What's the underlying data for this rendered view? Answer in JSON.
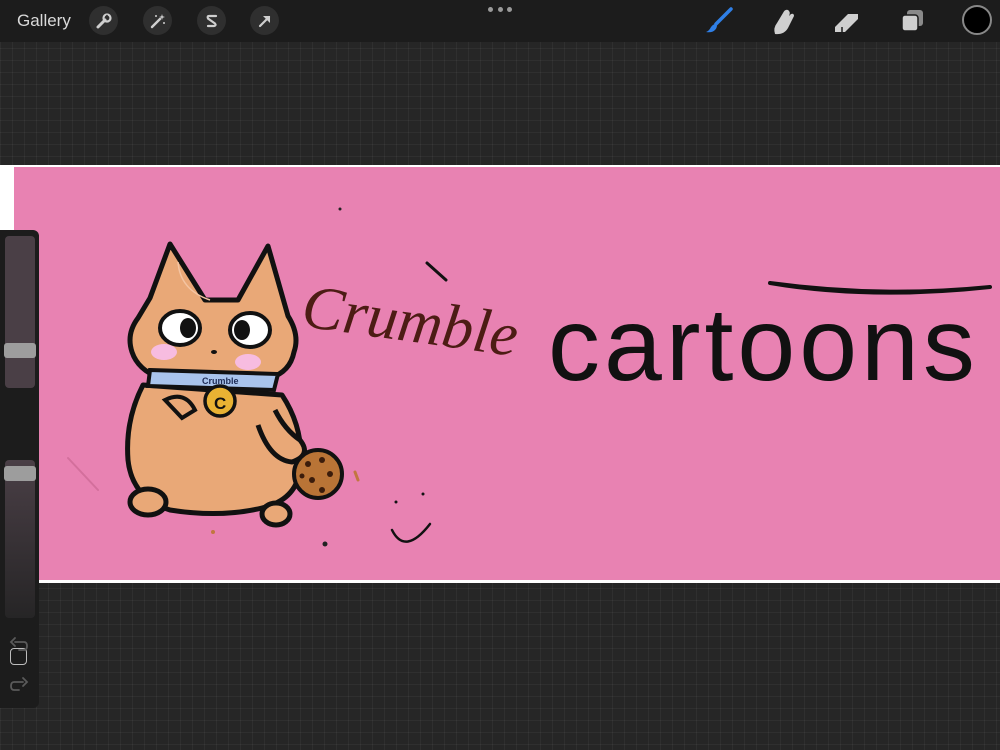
{
  "toolbar": {
    "gallery_label": "Gallery",
    "left_tools": [
      {
        "name": "actions",
        "icon": "wrench-icon"
      },
      {
        "name": "adjustments",
        "icon": "magic-wand-icon"
      },
      {
        "name": "selection",
        "icon": "selection-s-icon"
      },
      {
        "name": "transform",
        "icon": "arrow-cursor-icon"
      }
    ],
    "right_tools": [
      {
        "name": "brush",
        "icon": "brush-icon",
        "active": true
      },
      {
        "name": "smudge",
        "icon": "smudge-finger-icon"
      },
      {
        "name": "eraser",
        "icon": "eraser-icon"
      },
      {
        "name": "layers",
        "icon": "layers-icon"
      }
    ],
    "current_color": "#000000",
    "active_tool_color": "#2f7fe6"
  },
  "canvas": {
    "background_color": "#e882b2",
    "artwork_text": {
      "title_word_1": "Crumble",
      "title_word_2": "cartoons",
      "collar_tag": "Crumble",
      "medallion_letter": "C"
    }
  },
  "sidebar": {
    "brush_size_slider": "brush-size",
    "modify_button": "square-icon",
    "opacity_slider": "brush-opacity",
    "undo_icon": "undo-icon",
    "redo_icon": "redo-icon"
  }
}
